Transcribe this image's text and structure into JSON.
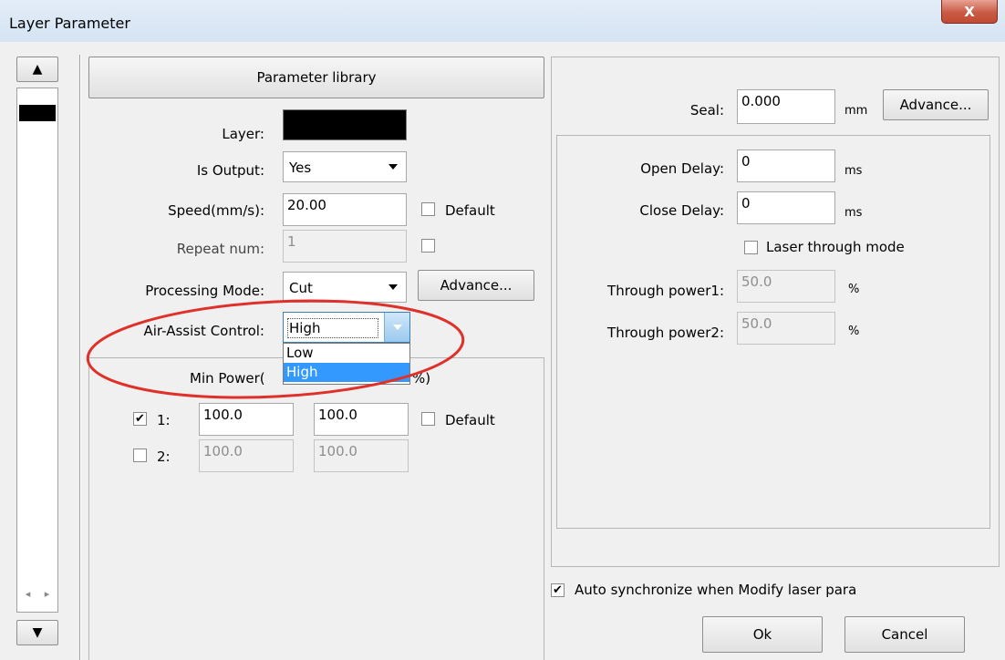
{
  "window": {
    "title": "Layer Parameter",
    "close_glyph": "X"
  },
  "layer_list": {
    "up_glyph": "▲",
    "down_glyph": "▼",
    "left_glyph": "◂",
    "right_glyph": "▸",
    "selected_color": "#000000"
  },
  "param_library_label": "Parameter library",
  "layer": {
    "label": "Layer:",
    "color": "#000000"
  },
  "is_output": {
    "label": "Is Output:",
    "value": "Yes"
  },
  "speed": {
    "label": "Speed(mm/s):",
    "value": "20.00",
    "default_label": "Default"
  },
  "repeat": {
    "label": "Repeat num:",
    "value": "1"
  },
  "processing_mode": {
    "label": "Processing Mode:",
    "value": "Cut",
    "advance_label": "Advance..."
  },
  "air_assist": {
    "label": "Air-Assist Control:",
    "value": "High",
    "options": [
      "Low",
      "High"
    ]
  },
  "power": {
    "min_label_left": "Min Power(",
    "min_label_right": "%)",
    "rows": [
      {
        "label": "1:",
        "checked": true,
        "min": "100.0",
        "max": "100.0"
      },
      {
        "label": "2:",
        "checked": false,
        "min": "100.0",
        "max": "100.0"
      }
    ],
    "default_label": "Default"
  },
  "seal": {
    "label": "Seal:",
    "value": "0.000",
    "unit": "mm",
    "advance_label": "Advance..."
  },
  "open_delay": {
    "label": "Open Delay:",
    "value": "0",
    "unit": "ms"
  },
  "close_delay": {
    "label": "Close Delay:",
    "value": "0",
    "unit": "ms"
  },
  "laser_through": {
    "label": "Laser through mode"
  },
  "through_power1": {
    "label": "Through power1:",
    "value": "50.0",
    "unit": "%"
  },
  "through_power2": {
    "label": "Through power2:",
    "value": "50.0",
    "unit": "%"
  },
  "auto_sync": {
    "label": "Auto synchronize when Modify laser para",
    "checked": true
  },
  "ok_label": "Ok",
  "cancel_label": "Cancel",
  "highlight_color": "#e0302a",
  "checkmark_glyph": "✔"
}
